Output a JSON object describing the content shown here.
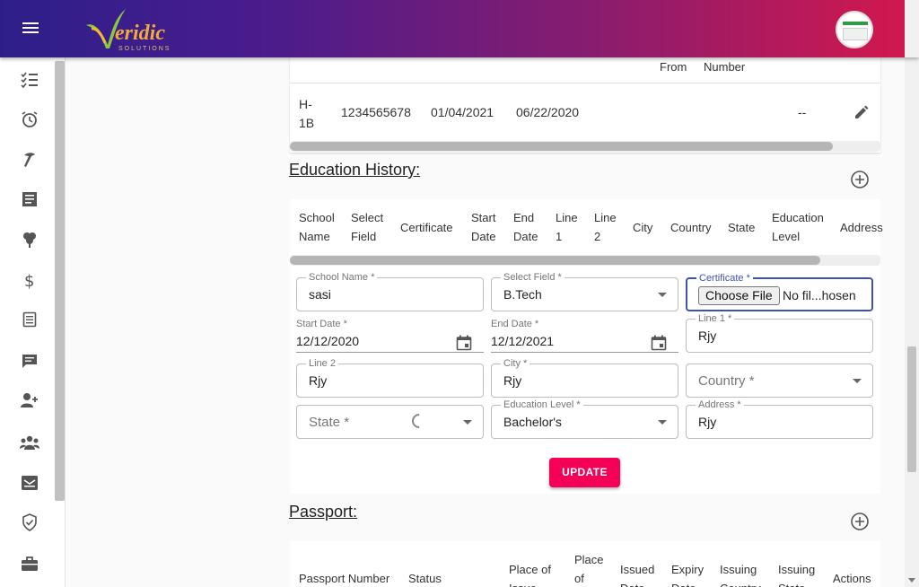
{
  "brand": {
    "logo_text": "eridic",
    "logo_sub": "SOLUTIONS"
  },
  "sidebar": {
    "icons": [
      "checklist-icon",
      "alarm-icon",
      "tools-icon",
      "article-icon",
      "tree-icon",
      "dollar-icon",
      "document-icon",
      "chat-icon",
      "person-add-icon",
      "group-icon",
      "mail-inbox-icon",
      "shield-check-icon",
      "briefcase-icon"
    ]
  },
  "visa_table": {
    "partial_headers": [
      "From",
      "Number"
    ],
    "row": {
      "type": "H-1B",
      "number": "1234565678",
      "start": "01/04/2021",
      "end": "06/22/2020",
      "dash": "--"
    }
  },
  "education": {
    "title": "Education History:",
    "headers": [
      "School Name",
      "Select Field",
      "Certificate",
      "Start Date",
      "End Date",
      "Line 1",
      "Line 2",
      "City",
      "Country",
      "State",
      "Education Level",
      "Address"
    ],
    "form": {
      "school_name_label": "School Name *",
      "school_name_value": "sasi",
      "select_field_label": "Select Field *",
      "select_field_value": "B.Tech",
      "certificate_label": "Certificate *",
      "choose_file_label": "Choose File",
      "file_status": "No fil...hosen",
      "start_date_label": "Start Date *",
      "start_date_value": "12/12/2020",
      "end_date_label": "End Date *",
      "end_date_value": "12/12/2021",
      "line1_label": "Line 1 *",
      "line1_value": "Rjy",
      "line2_label": "Line 2",
      "line2_value": "Rjy",
      "city_label": "City *",
      "city_value": "Rjy",
      "country_placeholder": "Country *",
      "state_placeholder": "State *",
      "education_level_label": "Education Level *",
      "education_level_value": "Bachelor's",
      "address_label": "Address *",
      "address_value": "Rjy"
    },
    "update_label": "UPDATE"
  },
  "passport": {
    "title": "Passport:",
    "headers": [
      "Passport Number",
      "Status",
      "Place of Issue",
      "Place of",
      "Issued Date",
      "Expiry Date",
      "Issuing Country",
      "Issuing State",
      "Actions"
    ]
  },
  "colors": {
    "accent": "#f50057",
    "focus": "#3f51b5",
    "topbar_start": "#2d1f8a",
    "topbar_end": "#d4184d"
  }
}
